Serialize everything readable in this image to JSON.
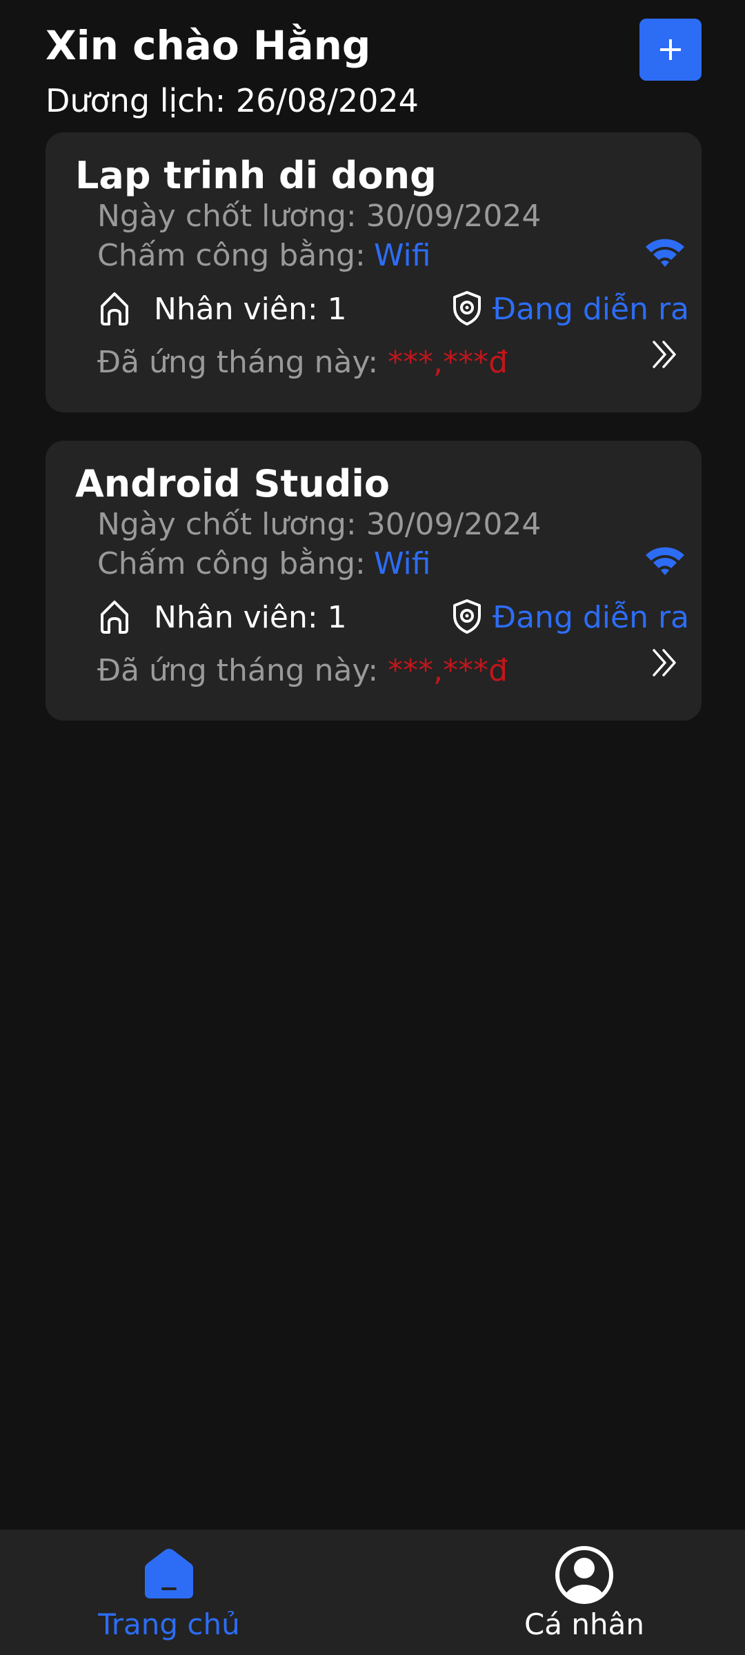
{
  "header": {
    "greeting": "Xin chào Hằng",
    "calendar_date": "Dương lịch: 26/08/2024"
  },
  "add_button": {
    "icon": "plus-icon",
    "label": "+"
  },
  "cards": [
    {
      "title": "Lap trinh di dong",
      "payroll_date": "Ngày chốt lương: 30/09/2024",
      "checkin_label": "Chấm công bằng:",
      "checkin_method": "Wifi",
      "employees": "Nhân viên: 1",
      "status": "Đang diễn ra",
      "advance_label": "Đã ứng tháng này:",
      "advance_value": "***,***đ",
      "icons": [
        "wifi-icon",
        "home-icon",
        "shield-gear-icon",
        "double-chevron-right-icon"
      ]
    },
    {
      "title": "Android Studio",
      "payroll_date": "Ngày chốt lương: 30/09/2024",
      "checkin_label": "Chấm công bằng:",
      "checkin_method": "Wifi",
      "employees": "Nhân viên: 1",
      "status": "Đang diễn ra",
      "advance_label": "Đã ứng tháng này:",
      "advance_value": "***,***đ",
      "icons": [
        "wifi-icon",
        "home-icon",
        "shield-gear-icon",
        "double-chevron-right-icon"
      ]
    }
  ],
  "bottom_nav": {
    "items": [
      {
        "label": "Trang chủ",
        "icon": "home-filled-icon",
        "active": true
      },
      {
        "label": "Cá nhân",
        "icon": "user-circle-icon",
        "active": false
      }
    ]
  },
  "colors": {
    "background": "#121212",
    "card": "#242424",
    "accent": "#2D6DF6",
    "muted_text": "#9a9a9a",
    "hidden_amount": "#c0161c",
    "nav_background": "#232323"
  }
}
